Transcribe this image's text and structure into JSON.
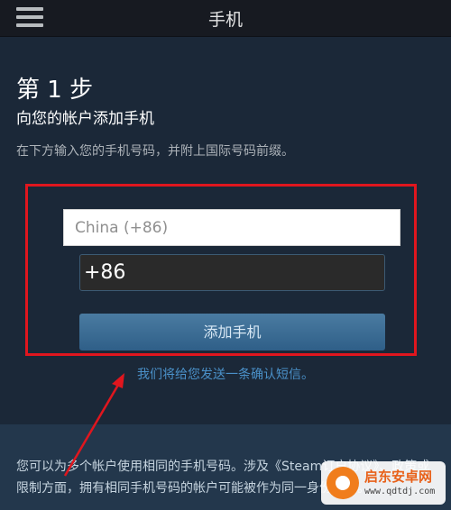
{
  "header": {
    "title": "手机",
    "menu_icon": "hamburger-menu-icon"
  },
  "step": {
    "title": "第 1 步",
    "subtitle": "向您的帐户添加手机",
    "instruction": "在下方输入您的手机号码，并附上国际号码前缀。"
  },
  "form": {
    "country_value": "China (+86)",
    "phone_value": "+86",
    "add_button_label": "添加手机",
    "confirm_note": "我们将给您发送一条确认短信。"
  },
  "footer": {
    "text": "您可以为多个帐户使用相同的手机号码。涉及《Steam订户协议》、政策或限制方面，拥有相同手机号码的帐户可能被作为同一身份对待。"
  },
  "watermark": {
    "name": "启东安卓网",
    "url": "www.qdtdj.com"
  },
  "colors": {
    "highlight": "#e0161e",
    "accent": "#4a90c8",
    "background": "#1b2838"
  }
}
